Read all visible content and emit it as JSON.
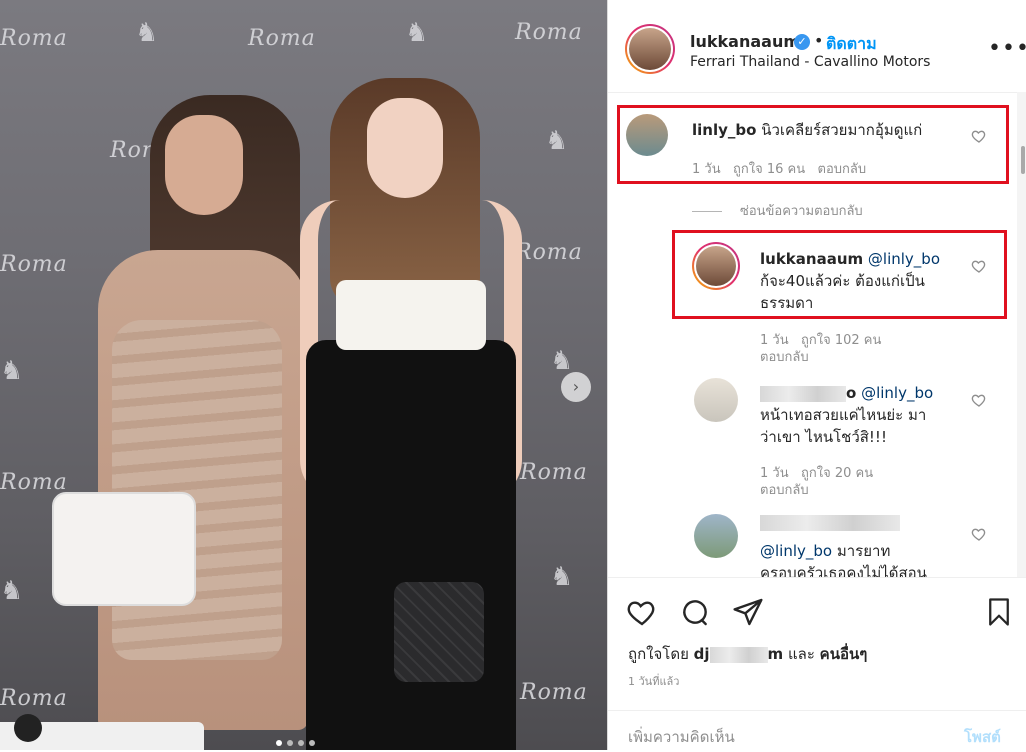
{
  "photo": {
    "watermark": "Roma",
    "carousel_dots": 4,
    "active_dot": 0
  },
  "post": {
    "username": "lukkanaaum",
    "separator": "•",
    "follow_label": "ติดตาม",
    "location": "Ferrari Thailand - Cavallino Motors",
    "more": "•••"
  },
  "comments": {
    "c1": {
      "username": "linly_bo",
      "text": "นิวเคลียร์สวยมากอุ้มดูแก่",
      "time": "1 วัน",
      "likes": "ถูกใจ 16 คน",
      "reply_label": "ตอบกลับ"
    },
    "hide_replies": "ซ่อนข้อความตอบกลับ",
    "r1": {
      "username": "lukkanaaum",
      "mention": "@linly_bo",
      "text_line1": "ก้จะ40แล้วค่ะ ต้องแก่เป็น",
      "text_line2": "ธรรมดา",
      "time": "1 วัน",
      "likes": "ถูกใจ 102 คน",
      "reply_label": "ตอบกลับ"
    },
    "r2": {
      "username_visible": "o",
      "mention": "@linly_bo",
      "text_line1": "หน้าเทอสวยแค่ไหนย่ะ มา",
      "text_line2": "ว่าเขา ไหนโชว์สิ!!!",
      "time": "1 วัน",
      "likes": "ถูกใจ 20 คน",
      "reply_label": "ตอบกลับ"
    },
    "r3": {
      "mention": "@linly_bo",
      "text_line1": "มารยาท",
      "text_line2": "ครอบครัวเธอคงไม่ได้สอน"
    }
  },
  "footer": {
    "liked_by_prefix": "ถูกใจโดย",
    "liked_by_user_visible": "dj",
    "liked_by_user_tail": "m",
    "liked_by_and": "และ",
    "liked_by_others": "คนอื่นๆ",
    "time_ago": "1 วันที่แล้ว",
    "add_comment_placeholder": "เพิ่มความคิดเห็น",
    "post_button": "โพสต์"
  },
  "colors": {
    "link_blue": "#0095f6",
    "highlight_red": "#e0101f",
    "text": "#262626",
    "muted": "#8e8e8e"
  }
}
